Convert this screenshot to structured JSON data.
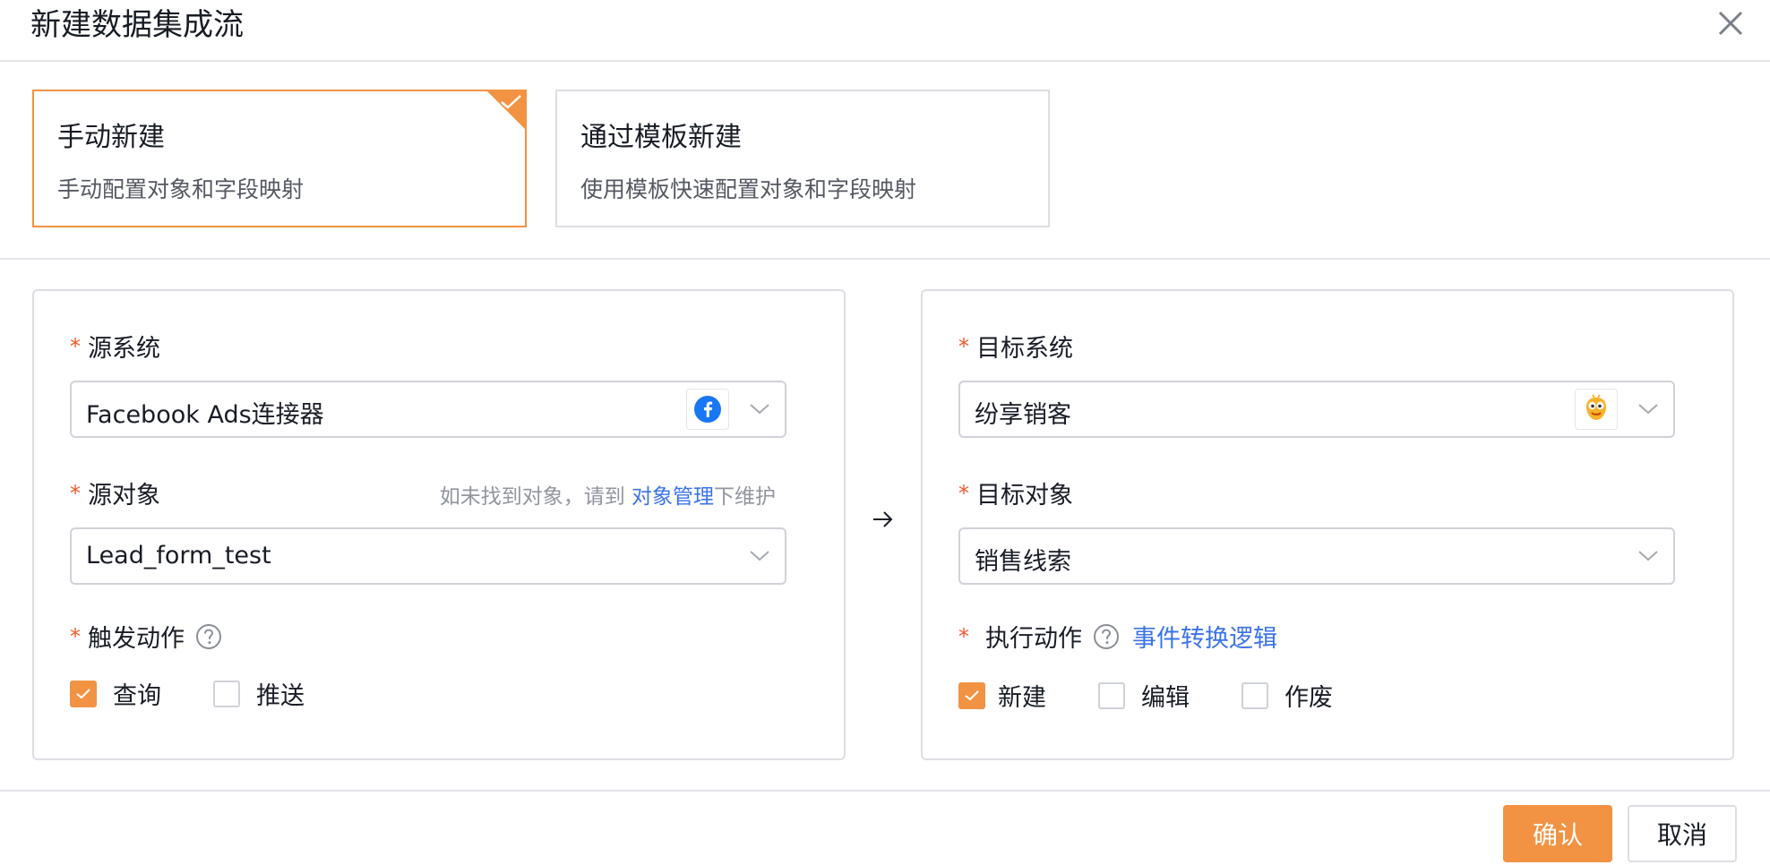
{
  "dialog": {
    "title": "新建数据集成流"
  },
  "modes": [
    {
      "title": "手动新建",
      "desc": "手动配置对象和字段映射"
    },
    {
      "title": "通过模板新建",
      "desc": "使用模板快速配置对象和字段映射"
    }
  ],
  "source": {
    "system_label": "源系统",
    "system_value": "Facebook Ads连接器",
    "object_label": "源对象",
    "object_hint_prefix": "如未找到对象，请到",
    "object_hint_link": "对象管理",
    "object_hint_suffix": "下维护",
    "object_value": "Lead_form_test",
    "trigger_label": "触发动作",
    "trigger_options": [
      {
        "label": "查询",
        "checked": true
      },
      {
        "label": "推送",
        "checked": false
      }
    ]
  },
  "target": {
    "system_label": "目标系统",
    "system_value": "纷享销客",
    "object_label": "目标对象",
    "object_value": "销售线索",
    "action_label": "执行动作",
    "action_link": "事件转换逻辑",
    "action_options": [
      {
        "label": "新建",
        "checked": true
      },
      {
        "label": "编辑",
        "checked": false
      },
      {
        "label": "作废",
        "checked": false
      }
    ]
  },
  "footer": {
    "confirm": "确认",
    "cancel": "取消"
  },
  "colors": {
    "accent": "#f29343",
    "link": "#3b73e8",
    "required": "#f4572e",
    "border": "#dcdee3"
  },
  "icons": {
    "source_logo": "facebook-logo",
    "target_logo": "fxiaoke-logo"
  }
}
